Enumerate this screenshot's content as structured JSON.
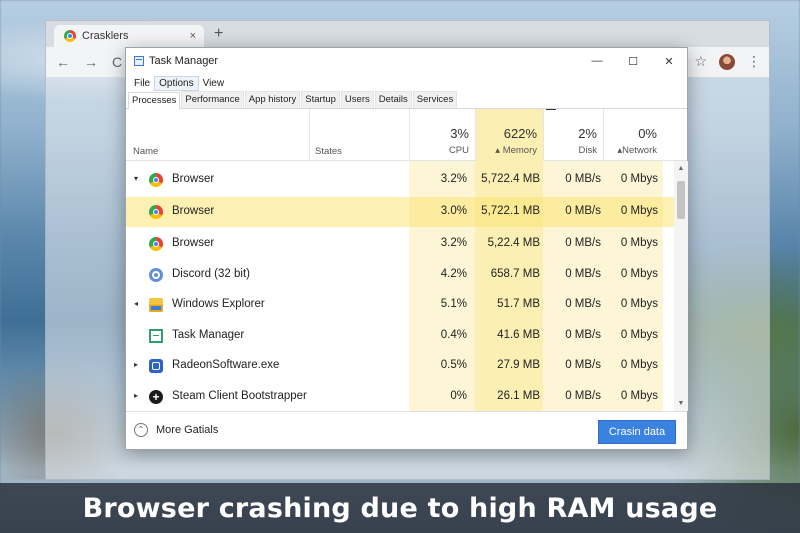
{
  "browser": {
    "tab_title": "Crasklers",
    "tab_close": "×",
    "new_tab": "+",
    "nav_back": "←",
    "nav_forward": "→",
    "nav_reload": "C",
    "star": "☆",
    "menu": "⋮"
  },
  "window": {
    "title": "Task Manager",
    "minimize": "—",
    "maximize": "☐",
    "close": "✕"
  },
  "menu": [
    "File",
    "Options",
    "View"
  ],
  "tabs": [
    "Processes",
    "Performance",
    "App history",
    "Startup",
    "Users",
    "Details",
    "Services"
  ],
  "columns": {
    "name": "Name",
    "status": "States",
    "cpu": {
      "pct": "3%",
      "label": "CPU"
    },
    "memory": {
      "pct": "622%",
      "label": "Memory",
      "sort": "▴"
    },
    "disk": {
      "pct": "2%",
      "label": "Disk"
    },
    "network": {
      "pct": "0%",
      "label": "Network",
      "sort": "▴"
    }
  },
  "processes": [
    {
      "expander": "▾",
      "icon": "chrome-icon",
      "name": "Browser",
      "cpu": "3.2%",
      "memory": "5,722.4 MB",
      "disk": "0 MB/s",
      "network": "0 Mbys"
    },
    {
      "expander": "",
      "icon": "chrome-icon",
      "name": "Browser",
      "cpu": "3.0%",
      "memory": "5,722.1 MB",
      "disk": "0 MB/s",
      "network": "0 Mbys",
      "selected": true
    },
    {
      "expander": "",
      "icon": "chrome-icon",
      "name": "Browser",
      "cpu": "3.2%",
      "memory": "5,22.4 MB",
      "disk": "0 MB/s",
      "network": "0 Mbys"
    },
    {
      "expander": "",
      "icon": "discord-icon",
      "name": "Discord (32 bit)",
      "cpu": "4.2%",
      "memory": "658.7 MB",
      "disk": "0 MB/s",
      "network": "0 Mbys"
    },
    {
      "expander": "◂",
      "icon": "folder-icon",
      "name": "Windows Explorer",
      "cpu": "5.1%",
      "memory": "51.7 MB",
      "disk": "0 MB/s",
      "network": "0 Mbys"
    },
    {
      "expander": "",
      "icon": "task-manager-icon",
      "name": "Task Manager",
      "cpu": "0.4%",
      "memory": "41.6 MB",
      "disk": "0 MB/s",
      "network": "0 Mbys"
    },
    {
      "expander": "▸",
      "icon": "radeon-icon",
      "name": "RadeonSoftware.exe",
      "cpu": "0.5%",
      "memory": "27.9 MB",
      "disk": "0 MB/s",
      "network": "0 Mbys"
    },
    {
      "expander": "▸",
      "icon": "steam-icon",
      "name": "Steam Client Bootstrapper",
      "cpu": "0%",
      "memory": "26.1 MB",
      "disk": "0 MB/s",
      "network": "0 Mbys"
    }
  ],
  "footer": {
    "more_details": "More Gatials",
    "end_task": "Crasin data"
  },
  "caption": "Browser crashing due to high RAM usage",
  "colors": {
    "memory_column": "#fbefb3",
    "selected_row": "#fae473",
    "end_task_button": "#3a82e0"
  }
}
